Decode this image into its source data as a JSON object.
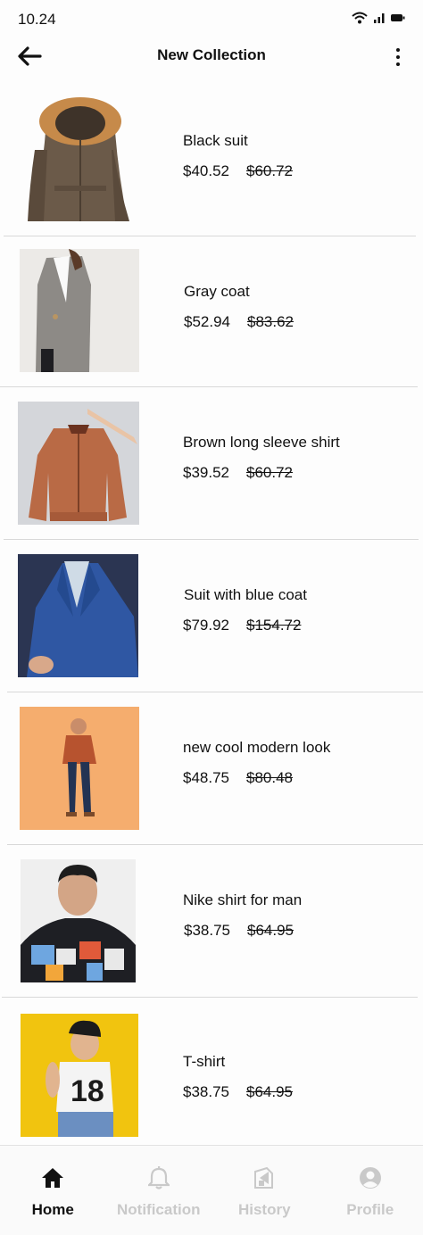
{
  "status_bar": {
    "time": "10.24",
    "icons": [
      "wifi-icon",
      "signal-icon",
      "battery-icon"
    ]
  },
  "app_bar": {
    "title": "New Collection",
    "back_icon": "arrow-left-icon",
    "menu_icon": "more-vertical-icon"
  },
  "products": [
    {
      "name": "Black suit",
      "price": "$40.52",
      "old_price": "$60.72"
    },
    {
      "name": "Gray coat",
      "price": "$52.94",
      "old_price": "$83.62"
    },
    {
      "name": "Brown long sleeve shirt",
      "price": "$39.52",
      "old_price": "$60.72"
    },
    {
      "name": "Suit with blue coat",
      "price": "$79.92",
      "old_price": "$154.72"
    },
    {
      "name": "new cool modern look",
      "price": "$48.75",
      "old_price": "$80.48"
    },
    {
      "name": "Nike shirt for man",
      "price": "$38.75",
      "old_price": "$64.95"
    },
    {
      "name": "T-shirt",
      "price": "$38.75",
      "old_price": "$64.95"
    }
  ],
  "bottom_nav": {
    "items": [
      {
        "label": "Home",
        "icon": "home-icon",
        "active": true
      },
      {
        "label": "Notification",
        "icon": "bell-icon",
        "active": false
      },
      {
        "label": "History",
        "icon": "history-icon",
        "active": false
      },
      {
        "label": "Profile",
        "icon": "profile-icon",
        "active": false
      }
    ]
  },
  "colors": {
    "active": "#111111",
    "inactive": "#c9c9c9",
    "background": "#fdfdfd",
    "divider": "#d8d8d8"
  }
}
